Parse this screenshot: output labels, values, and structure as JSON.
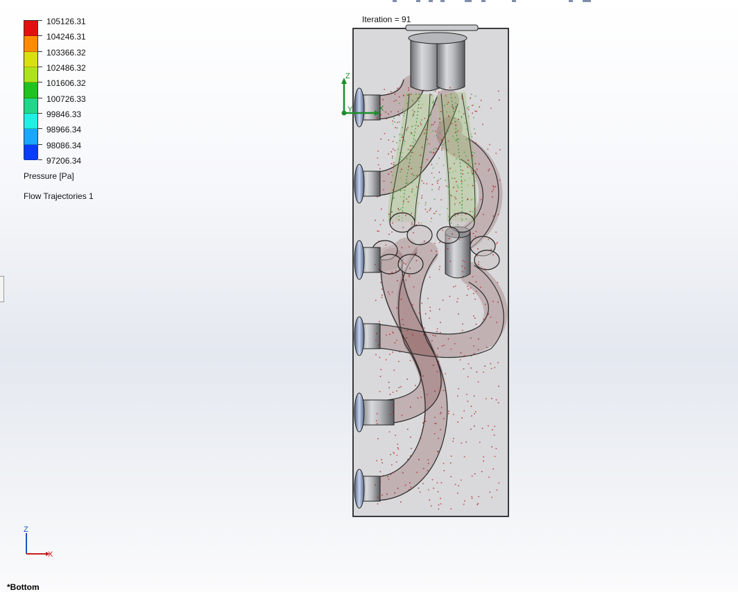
{
  "legend": {
    "values": [
      "105126.31",
      "104246.31",
      "103366.32",
      "102486.32",
      "101606.32",
      "100726.33",
      "99846.33",
      "98966.34",
      "98086.34",
      "97206.34"
    ],
    "colors": [
      "#e41010",
      "#ff8c00",
      "#d9e010",
      "#aee31c",
      "#1fc31f",
      "#1fd88a",
      "#1ff0e3",
      "#18a8ff",
      "#0a3cff"
    ],
    "parameter": "Pressure [Pa]",
    "series_label": "Flow Trajectories 1"
  },
  "viewport": {
    "iteration_label": "Iteration = 91",
    "triad": {
      "z": "Z",
      "y": "Y",
      "x": "X"
    }
  },
  "view": {
    "name": "*Bottom",
    "triad": {
      "z": "Z",
      "x": "X"
    }
  }
}
